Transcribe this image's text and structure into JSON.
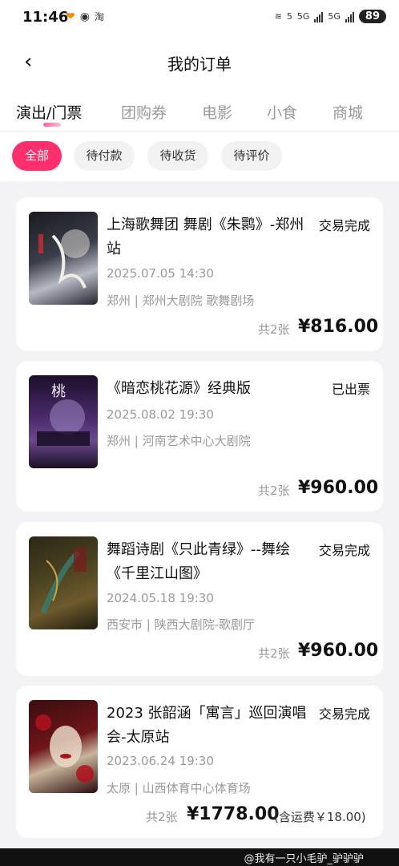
{
  "status_bar": {
    "time": "11:46",
    "battery": "89",
    "net1": "5",
    "net2": "5G",
    "net3": "5G"
  },
  "header": {
    "title": "我的订单"
  },
  "tabs": [
    "演出/门票",
    "团购券",
    "电影",
    "小食",
    "商城"
  ],
  "filters": [
    "全部",
    "待付款",
    "待收货",
    "待评价"
  ],
  "orders": [
    {
      "title": "上海歌舞团 舞剧《朱鹮》-郑州站",
      "status": "交易完成",
      "time": "2025.07.05 14:30",
      "venue": "郑州 | 郑州大剧院 歌舞剧场",
      "count": "共2张",
      "price": "¥816.00",
      "shipping": ""
    },
    {
      "title": "《暗恋桃花源》经典版",
      "status": "已出票",
      "time": "2025.08.02 19:30",
      "venue": "郑州 | 河南艺术中心大剧院",
      "count": "共2张",
      "price": "¥960.00",
      "shipping": ""
    },
    {
      "title": "舞蹈诗剧《只此青绿》--舞绘《千里江山图》",
      "status": "交易完成",
      "time": "2024.05.18 19:30",
      "venue": "西安市 | 陕西大剧院-歌剧厅",
      "count": "共2张",
      "price": "¥960.00",
      "shipping": ""
    },
    {
      "title": "2023 张韶涵「寓言」巡回演唱会-太原站",
      "status": "交易完成",
      "time": "2023.06.24 19:30",
      "venue": "太原 | 山西体育中心体育场",
      "count": "共2张",
      "price": "¥1778.00",
      "shipping": "(含运费￥18.00)"
    }
  ],
  "watermark": "@我有一只小毛驴_驴驴驴",
  "colors": {
    "accent": "#ff2f6d",
    "status_text": "#111111",
    "muted": "#9a9a9a"
  }
}
